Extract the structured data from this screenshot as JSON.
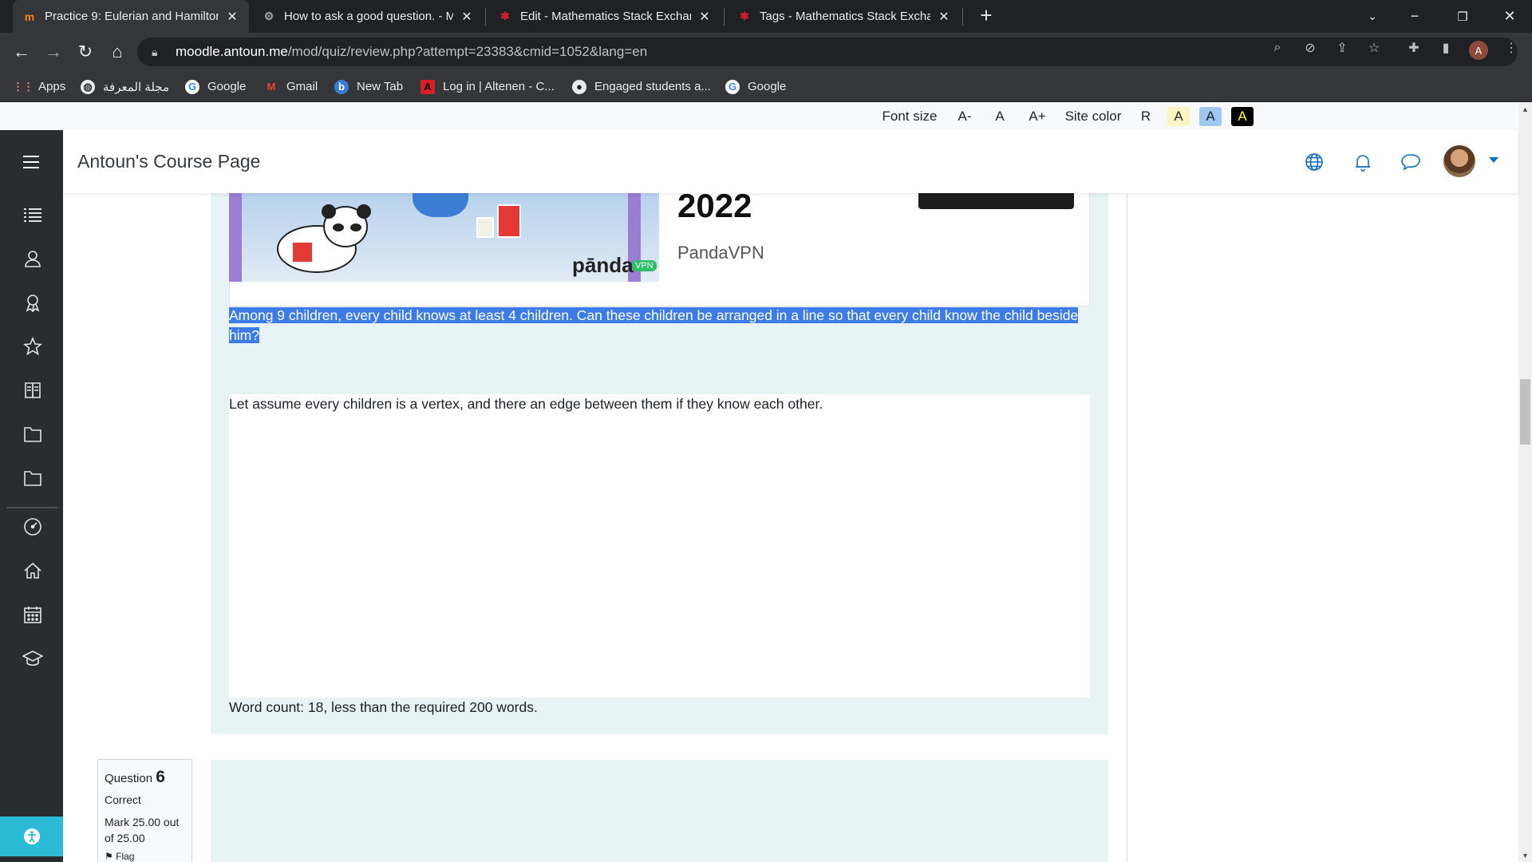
{
  "browser": {
    "tabs": [
      {
        "title": "Practice 9: Eulerian and Hamilton",
        "favicon": "moodle-icon",
        "active": true
      },
      {
        "title": "How to ask a good question. - M",
        "favicon": "gear-icon",
        "active": false
      },
      {
        "title": "Edit - Mathematics Stack Exchan",
        "favicon": "math-se-icon",
        "active": false
      },
      {
        "title": "Tags - Mathematics Stack Exchan",
        "favicon": "math-se-icon",
        "active": false
      }
    ],
    "url_host": "moodle.antoun.me",
    "url_path": "/mod/quiz/review.php?attempt=23383&cmid=1052&lang=en",
    "profile_initial": "A",
    "bookmarks": [
      {
        "label": "Apps",
        "icon": "apps-grid-icon"
      },
      {
        "label": "مجلة المعرفة",
        "icon": "globe-icon"
      },
      {
        "label": "Google",
        "icon": "google-icon"
      },
      {
        "label": "Gmail",
        "icon": "gmail-icon"
      },
      {
        "label": "New Tab",
        "icon": "newtab-icon"
      },
      {
        "label": "Log in | Altenen - C...",
        "icon": "altenen-icon"
      },
      {
        "label": "Engaged students a...",
        "icon": "github-icon"
      },
      {
        "label": "Google",
        "icon": "google-icon"
      }
    ]
  },
  "a11y": {
    "font_size_label": "Font size",
    "font_dec": "A-",
    "font_reset": "A",
    "font_inc": "A+",
    "site_color_label": "Site color",
    "color_reset": "R",
    "swatch_yellow": "A",
    "swatch_blue": "A",
    "swatch_black": "A"
  },
  "header": {
    "site_title": "Antoun's Course Page"
  },
  "ad": {
    "year": "2022",
    "brand": "PandaVPN",
    "logo_text": "pānda",
    "logo_badge": "VPN"
  },
  "question": {
    "text": "Among 9 children, every child knows at least 4 children. Can these children be arranged in a line so that every child know the child beside him?",
    "answer": "Let assume every children is a vertex, and there an edge between them if they know each other.",
    "word_count": "Word count: 18, less than the required 200 words."
  },
  "next_question": {
    "label": "Question",
    "number": "6",
    "state": "Correct",
    "grade": "Mark 25.00 out of 25.00",
    "flag": "Flag"
  },
  "colors": {
    "selection": "#3d7ce8",
    "panel": "#e7f3f5",
    "nav_bg": "#2a2d30",
    "accent": "#0f6cbf",
    "fab": "#2bbbd6"
  }
}
